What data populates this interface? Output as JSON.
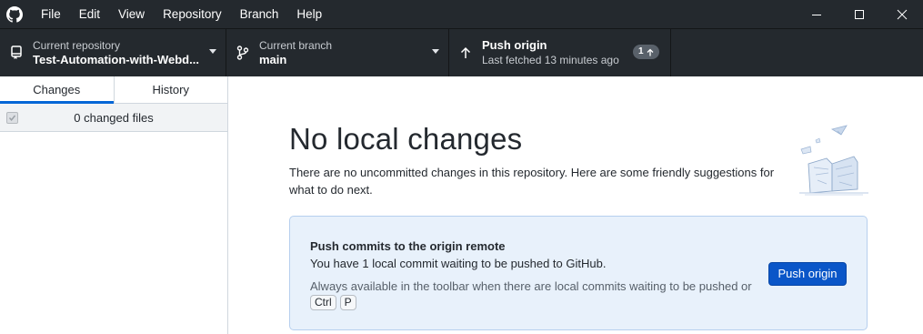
{
  "menu": {
    "items": [
      "File",
      "Edit",
      "View",
      "Repository",
      "Branch",
      "Help"
    ]
  },
  "icons": {
    "app": "github-icon",
    "minimize": "minimize-icon",
    "maximize": "maximize-icon",
    "close": "close-icon",
    "repo": "repo-icon",
    "branch": "git-branch-icon",
    "push": "arrow-up-icon"
  },
  "toolbar": {
    "repo": {
      "label": "Current repository",
      "value": "Test-Automation-with-Webd..."
    },
    "branch": {
      "label": "Current branch",
      "value": "main"
    },
    "push": {
      "title": "Push origin",
      "subtitle": "Last fetched 13 minutes ago",
      "badge": "1"
    }
  },
  "sidebar": {
    "tabs": [
      "Changes",
      "History"
    ],
    "active_tab": "Changes",
    "changed_files": "0 changed files"
  },
  "main": {
    "title": "No local changes",
    "description": "There are no uncommitted changes in this repository. Here are some friendly suggestions for what to do next.",
    "suggestion": {
      "title": "Push commits to the origin remote",
      "description": "You have 1 local commit waiting to be pushed to GitHub.",
      "hint": "Always available in the toolbar when there are local commits waiting to be pushed or",
      "shortcut": [
        "Ctrl",
        "P"
      ],
      "button_label": "Push origin"
    }
  },
  "colors": {
    "chrome": "#24292e",
    "accent": "#0366d6",
    "button": "#0a56c8",
    "suggestion_bg": "#e8f1fb"
  }
}
